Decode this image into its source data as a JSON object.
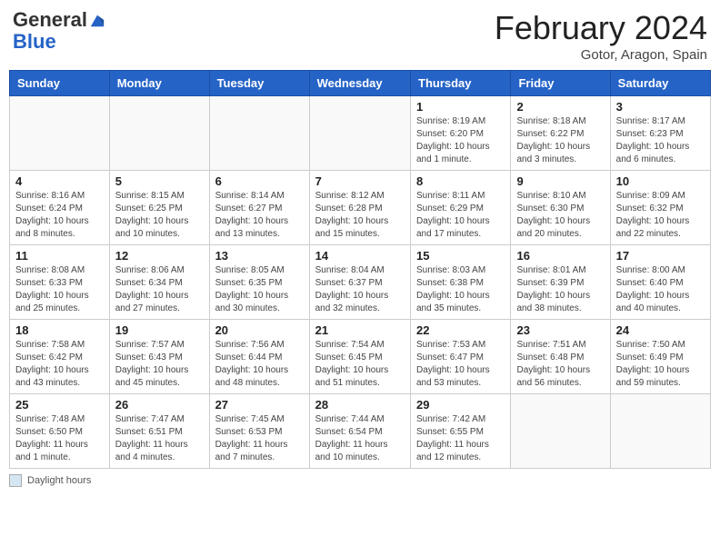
{
  "header": {
    "logo_line1": "General",
    "logo_line2": "Blue",
    "month_title": "February 2024",
    "location": "Gotor, Aragon, Spain"
  },
  "days_of_week": [
    "Sunday",
    "Monday",
    "Tuesday",
    "Wednesday",
    "Thursday",
    "Friday",
    "Saturday"
  ],
  "weeks": [
    [
      {
        "day": "",
        "info": ""
      },
      {
        "day": "",
        "info": ""
      },
      {
        "day": "",
        "info": ""
      },
      {
        "day": "",
        "info": ""
      },
      {
        "day": "1",
        "info": "Sunrise: 8:19 AM\nSunset: 6:20 PM\nDaylight: 10 hours and 1 minute."
      },
      {
        "day": "2",
        "info": "Sunrise: 8:18 AM\nSunset: 6:22 PM\nDaylight: 10 hours and 3 minutes."
      },
      {
        "day": "3",
        "info": "Sunrise: 8:17 AM\nSunset: 6:23 PM\nDaylight: 10 hours and 6 minutes."
      }
    ],
    [
      {
        "day": "4",
        "info": "Sunrise: 8:16 AM\nSunset: 6:24 PM\nDaylight: 10 hours and 8 minutes."
      },
      {
        "day": "5",
        "info": "Sunrise: 8:15 AM\nSunset: 6:25 PM\nDaylight: 10 hours and 10 minutes."
      },
      {
        "day": "6",
        "info": "Sunrise: 8:14 AM\nSunset: 6:27 PM\nDaylight: 10 hours and 13 minutes."
      },
      {
        "day": "7",
        "info": "Sunrise: 8:12 AM\nSunset: 6:28 PM\nDaylight: 10 hours and 15 minutes."
      },
      {
        "day": "8",
        "info": "Sunrise: 8:11 AM\nSunset: 6:29 PM\nDaylight: 10 hours and 17 minutes."
      },
      {
        "day": "9",
        "info": "Sunrise: 8:10 AM\nSunset: 6:30 PM\nDaylight: 10 hours and 20 minutes."
      },
      {
        "day": "10",
        "info": "Sunrise: 8:09 AM\nSunset: 6:32 PM\nDaylight: 10 hours and 22 minutes."
      }
    ],
    [
      {
        "day": "11",
        "info": "Sunrise: 8:08 AM\nSunset: 6:33 PM\nDaylight: 10 hours and 25 minutes."
      },
      {
        "day": "12",
        "info": "Sunrise: 8:06 AM\nSunset: 6:34 PM\nDaylight: 10 hours and 27 minutes."
      },
      {
        "day": "13",
        "info": "Sunrise: 8:05 AM\nSunset: 6:35 PM\nDaylight: 10 hours and 30 minutes."
      },
      {
        "day": "14",
        "info": "Sunrise: 8:04 AM\nSunset: 6:37 PM\nDaylight: 10 hours and 32 minutes."
      },
      {
        "day": "15",
        "info": "Sunrise: 8:03 AM\nSunset: 6:38 PM\nDaylight: 10 hours and 35 minutes."
      },
      {
        "day": "16",
        "info": "Sunrise: 8:01 AM\nSunset: 6:39 PM\nDaylight: 10 hours and 38 minutes."
      },
      {
        "day": "17",
        "info": "Sunrise: 8:00 AM\nSunset: 6:40 PM\nDaylight: 10 hours and 40 minutes."
      }
    ],
    [
      {
        "day": "18",
        "info": "Sunrise: 7:58 AM\nSunset: 6:42 PM\nDaylight: 10 hours and 43 minutes."
      },
      {
        "day": "19",
        "info": "Sunrise: 7:57 AM\nSunset: 6:43 PM\nDaylight: 10 hours and 45 minutes."
      },
      {
        "day": "20",
        "info": "Sunrise: 7:56 AM\nSunset: 6:44 PM\nDaylight: 10 hours and 48 minutes."
      },
      {
        "day": "21",
        "info": "Sunrise: 7:54 AM\nSunset: 6:45 PM\nDaylight: 10 hours and 51 minutes."
      },
      {
        "day": "22",
        "info": "Sunrise: 7:53 AM\nSunset: 6:47 PM\nDaylight: 10 hours and 53 minutes."
      },
      {
        "day": "23",
        "info": "Sunrise: 7:51 AM\nSunset: 6:48 PM\nDaylight: 10 hours and 56 minutes."
      },
      {
        "day": "24",
        "info": "Sunrise: 7:50 AM\nSunset: 6:49 PM\nDaylight: 10 hours and 59 minutes."
      }
    ],
    [
      {
        "day": "25",
        "info": "Sunrise: 7:48 AM\nSunset: 6:50 PM\nDaylight: 11 hours and 1 minute."
      },
      {
        "day": "26",
        "info": "Sunrise: 7:47 AM\nSunset: 6:51 PM\nDaylight: 11 hours and 4 minutes."
      },
      {
        "day": "27",
        "info": "Sunrise: 7:45 AM\nSunset: 6:53 PM\nDaylight: 11 hours and 7 minutes."
      },
      {
        "day": "28",
        "info": "Sunrise: 7:44 AM\nSunset: 6:54 PM\nDaylight: 11 hours and 10 minutes."
      },
      {
        "day": "29",
        "info": "Sunrise: 7:42 AM\nSunset: 6:55 PM\nDaylight: 11 hours and 12 minutes."
      },
      {
        "day": "",
        "info": ""
      },
      {
        "day": "",
        "info": ""
      }
    ]
  ],
  "footer": {
    "box_label": "Daylight hours"
  }
}
